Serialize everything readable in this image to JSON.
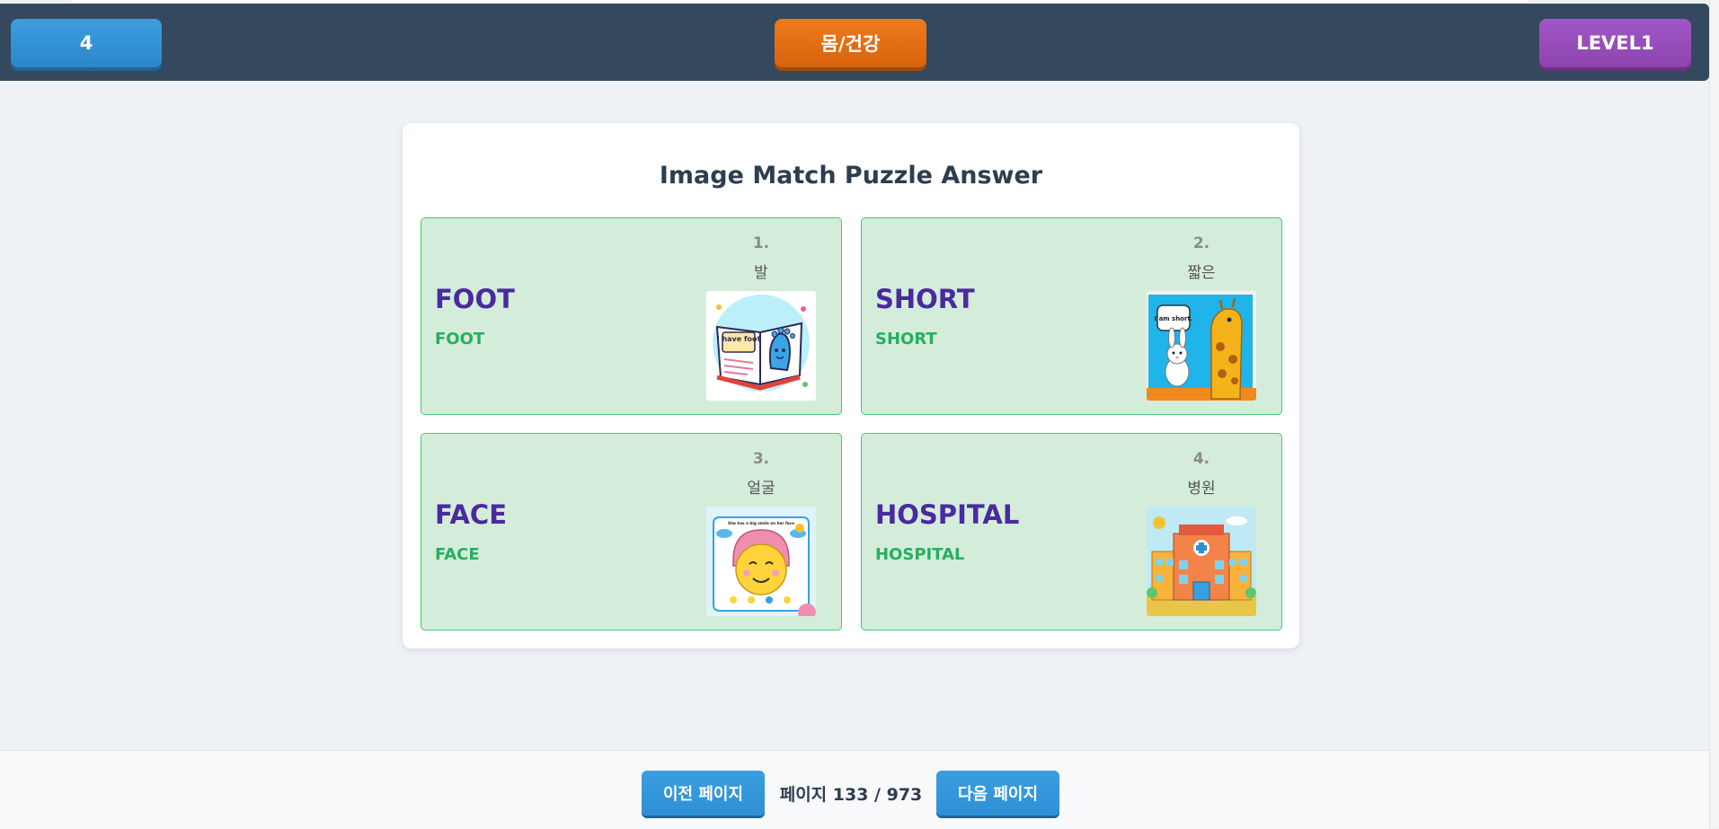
{
  "header": {
    "count_label": "4",
    "category_label": "몸/건강",
    "level_label": "LEVEL1"
  },
  "puzzle": {
    "title": "Image Match Puzzle Answer",
    "items": [
      {
        "number": "1.",
        "korean": "발",
        "word": "FOOT",
        "answer": "FOOT",
        "image_text": "I have foot"
      },
      {
        "number": "2.",
        "korean": "짧은",
        "word": "SHORT",
        "answer": "SHORT",
        "image_text": "I am short."
      },
      {
        "number": "3.",
        "korean": "얼굴",
        "word": "FACE",
        "answer": "FACE",
        "image_text": "She has a big smile on her face"
      },
      {
        "number": "4.",
        "korean": "병원",
        "word": "HOSPITAL",
        "answer": "HOSPITAL"
      }
    ]
  },
  "footer": {
    "prev_label": "이전 페이지",
    "page_info": "페이지 133 / 973",
    "next_label": "다음 페이지"
  }
}
